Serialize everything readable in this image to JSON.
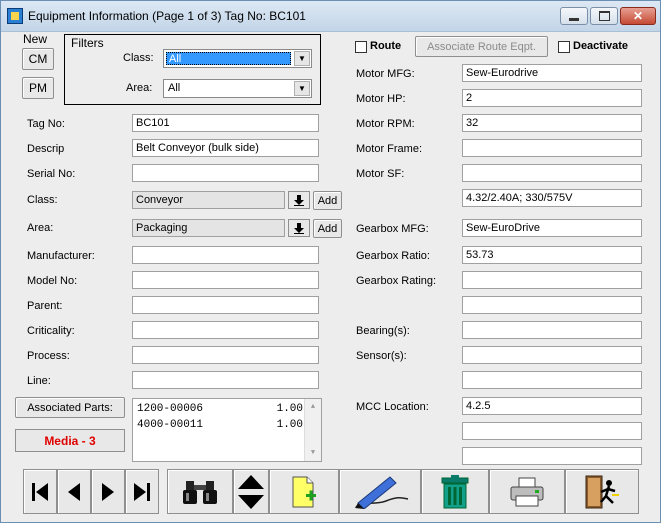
{
  "window": {
    "title": "Equipment Information (Page 1 of 3) Tag No: BC101",
    "close_glyph": "✕"
  },
  "new_panel": {
    "label": "New",
    "cm": "CM",
    "pm": "PM"
  },
  "filters": {
    "legend": "Filters",
    "class_label": "Class:",
    "class_value": "All",
    "area_label": "Area:",
    "area_value": "All"
  },
  "left_fields": [
    {
      "label": "Tag No:",
      "value": "BC101"
    },
    {
      "label": "Descrip",
      "value": "Belt Conveyor (bulk side)"
    },
    {
      "label": "Serial No:",
      "value": ""
    }
  ],
  "class_row": {
    "label": "Class:",
    "value": "Conveyor",
    "add": "Add"
  },
  "area_row": {
    "label": "Area:",
    "value": "Packaging",
    "add": "Add"
  },
  "lower_fields": [
    {
      "label": "Manufacturer:",
      "value": ""
    },
    {
      "label": "Model No:",
      "value": ""
    },
    {
      "label": "Parent:",
      "value": ""
    },
    {
      "label": "Criticality:",
      "value": ""
    },
    {
      "label": "Process:",
      "value": ""
    },
    {
      "label": "Line:",
      "value": ""
    }
  ],
  "associated_parts": {
    "button": "Associated Parts:",
    "items": [
      {
        "part": "1200-00006",
        "qty": "1.00"
      },
      {
        "part": "4000-00011",
        "qty": "1.00"
      }
    ]
  },
  "media_button": "Media - 3",
  "route": {
    "label": "Route",
    "assoc_button": "Associate Route Eqpt.",
    "deactivate": "Deactivate"
  },
  "right_fields": {
    "motor_mfg": {
      "label": "Motor MFG:",
      "value": "Sew-Eurodrive"
    },
    "motor_hp": {
      "label": "Motor HP:",
      "value": "2"
    },
    "motor_rpm": {
      "label": "Motor RPM:",
      "value": "32"
    },
    "motor_frame": {
      "label": "Motor Frame:",
      "value": ""
    },
    "motor_sf": {
      "label": "Motor SF:",
      "value": ""
    },
    "motor_extra": {
      "value": "4.32/2.40A; 330/575V"
    },
    "gearbox_mfg": {
      "label": "Gearbox MFG:",
      "value": "Sew-EuroDrive"
    },
    "gearbox_ratio": {
      "label": "Gearbox Ratio:",
      "value": "53.73"
    },
    "gearbox_rating": {
      "label": "Gearbox Rating:",
      "value": ""
    },
    "gearbox_extra": {
      "value": ""
    },
    "bearings": {
      "label": "Bearing(s):",
      "value": ""
    },
    "sensors": {
      "label": "Sensor(s):",
      "value": ""
    },
    "sensors_extra": {
      "value": ""
    },
    "mcc_location": {
      "label": "MCC Location:",
      "value": "4.2.5"
    },
    "mcc_extra1": {
      "value": ""
    },
    "mcc_extra2": {
      "value": ""
    }
  },
  "toolbar_icons": [
    "first-record-icon",
    "previous-record-icon",
    "next-record-icon",
    "last-record-icon",
    "binoculars-icon",
    "up-down-icon",
    "new-document-icon",
    "signature-pen-icon",
    "trash-bin-icon",
    "printer-icon",
    "exit-door-icon"
  ],
  "colors": {
    "media_text": "#e00000",
    "selection": "#3399ff"
  }
}
